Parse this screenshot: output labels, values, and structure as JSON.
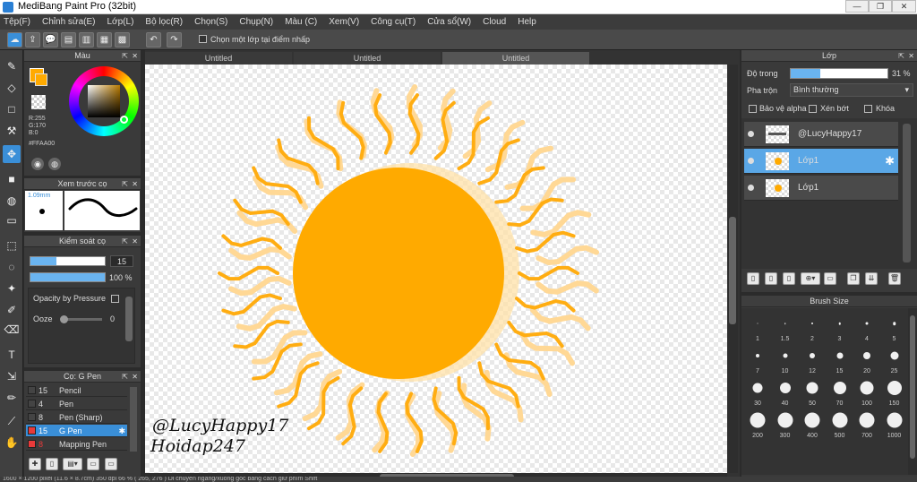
{
  "window": {
    "title": "MediBang Paint Pro (32bit)"
  },
  "menu": [
    "Tệp(F)",
    "Chỉnh sửa(E)",
    "Lớp(L)",
    "Bộ lọc(R)",
    "Chọn(S)",
    "Chụp(N)",
    "Màu (C)",
    "Xem(V)",
    "Công cụ(T)",
    "Cửa sổ(W)",
    "Cloud",
    "Help"
  ],
  "toolbar": {
    "snap_label": "Chọn một lớp tại điểm nhấp"
  },
  "color_panel": {
    "title": "Màu",
    "r": "R:255",
    "g": "G:170",
    "b": "B:0",
    "hex": "#FFAA00",
    "primary": "#ffaa00"
  },
  "brush_preview": {
    "title": "Xem trước cọ",
    "size": "1.09mm"
  },
  "brush_control": {
    "title": "Kiểm soát cọ",
    "size_value": "15",
    "opacity_value": "100 %",
    "size_fraction": 0.35,
    "opacity_fraction": 1.0,
    "pressure_label": "Opacity by Pressure",
    "ooze_label": "Ooze",
    "ooze_value": "0"
  },
  "brush_list": {
    "title": "Cọ: G Pen",
    "items": [
      {
        "size": "15",
        "name": "Pencil",
        "color": "#444444",
        "selected": false
      },
      {
        "size": "4",
        "name": "Pen",
        "color": "#444444",
        "selected": false
      },
      {
        "size": "8",
        "name": "Pen (Sharp)",
        "color": "#444444",
        "selected": false
      },
      {
        "size": "15",
        "name": "G Pen",
        "color": "#e83a3a",
        "selected": true
      },
      {
        "size": "8",
        "name": "Mapping Pen",
        "color": "#e83a3a",
        "selected": false
      }
    ]
  },
  "documents": {
    "tabs": [
      "Untitled",
      "Untitled",
      "Untitled"
    ]
  },
  "canvas": {
    "sig1": "@LucyHappy17",
    "sig2": "Hoidap247"
  },
  "layer_panel": {
    "title": "Lớp",
    "opacity_label": "Độ trong",
    "opacity_value": "31 %",
    "opacity_fraction": 0.31,
    "blend_label": "Pha trộn",
    "blend_value": "Bình thường",
    "protect_alpha": "Bảo vệ alpha",
    "clipping": "Xén bớt",
    "lock": "Khóa",
    "layers": [
      {
        "name": "@LucyHappy17",
        "selected": false
      },
      {
        "name": "Lớp1",
        "selected": true
      },
      {
        "name": "Lớp1",
        "selected": false
      }
    ]
  },
  "brush_size_panel": {
    "title": "Brush Size",
    "sizes": [
      "1",
      "1.5",
      "2",
      "3",
      "4",
      "5",
      "7",
      "10",
      "12",
      "15",
      "20",
      "25",
      "30",
      "40",
      "50",
      "70",
      "100",
      "150",
      "200",
      "300",
      "400",
      "500",
      "700",
      "1000"
    ]
  },
  "status": {
    "text": "1600 × 1200 pixel  (11.6 × 8.7cm)  350 dpi  66 %  ( 265, 276 )  Di chuyển ngang/xuống góc bằng cách giữ phím Shift"
  }
}
